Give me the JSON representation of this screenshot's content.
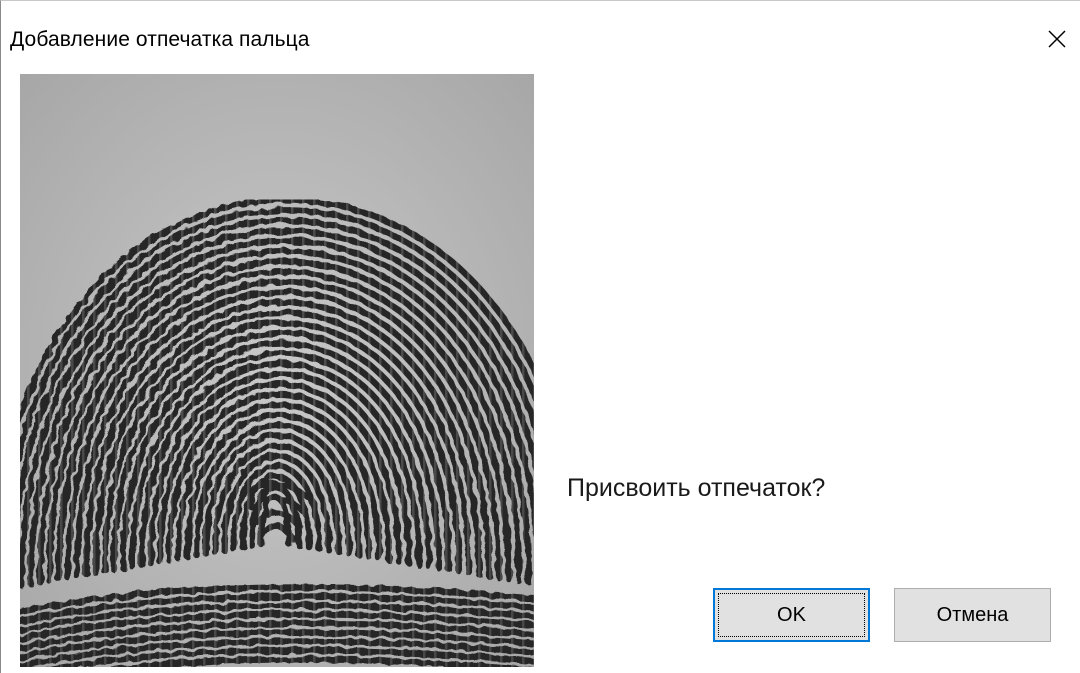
{
  "window": {
    "title": "Добавление отпечатка пальца",
    "close_glyph": "✕"
  },
  "content": {
    "fingerprint_image": "fingerprint-scan",
    "prompt": "Присвоить отпечаток?"
  },
  "buttons": {
    "ok_label": "OK",
    "cancel_label": "Отмена"
  },
  "colors": {
    "focus_border": "#0078d7",
    "button_bg": "#e1e1e1",
    "ridge": "#262626",
    "valley": "#bdbdbd"
  }
}
